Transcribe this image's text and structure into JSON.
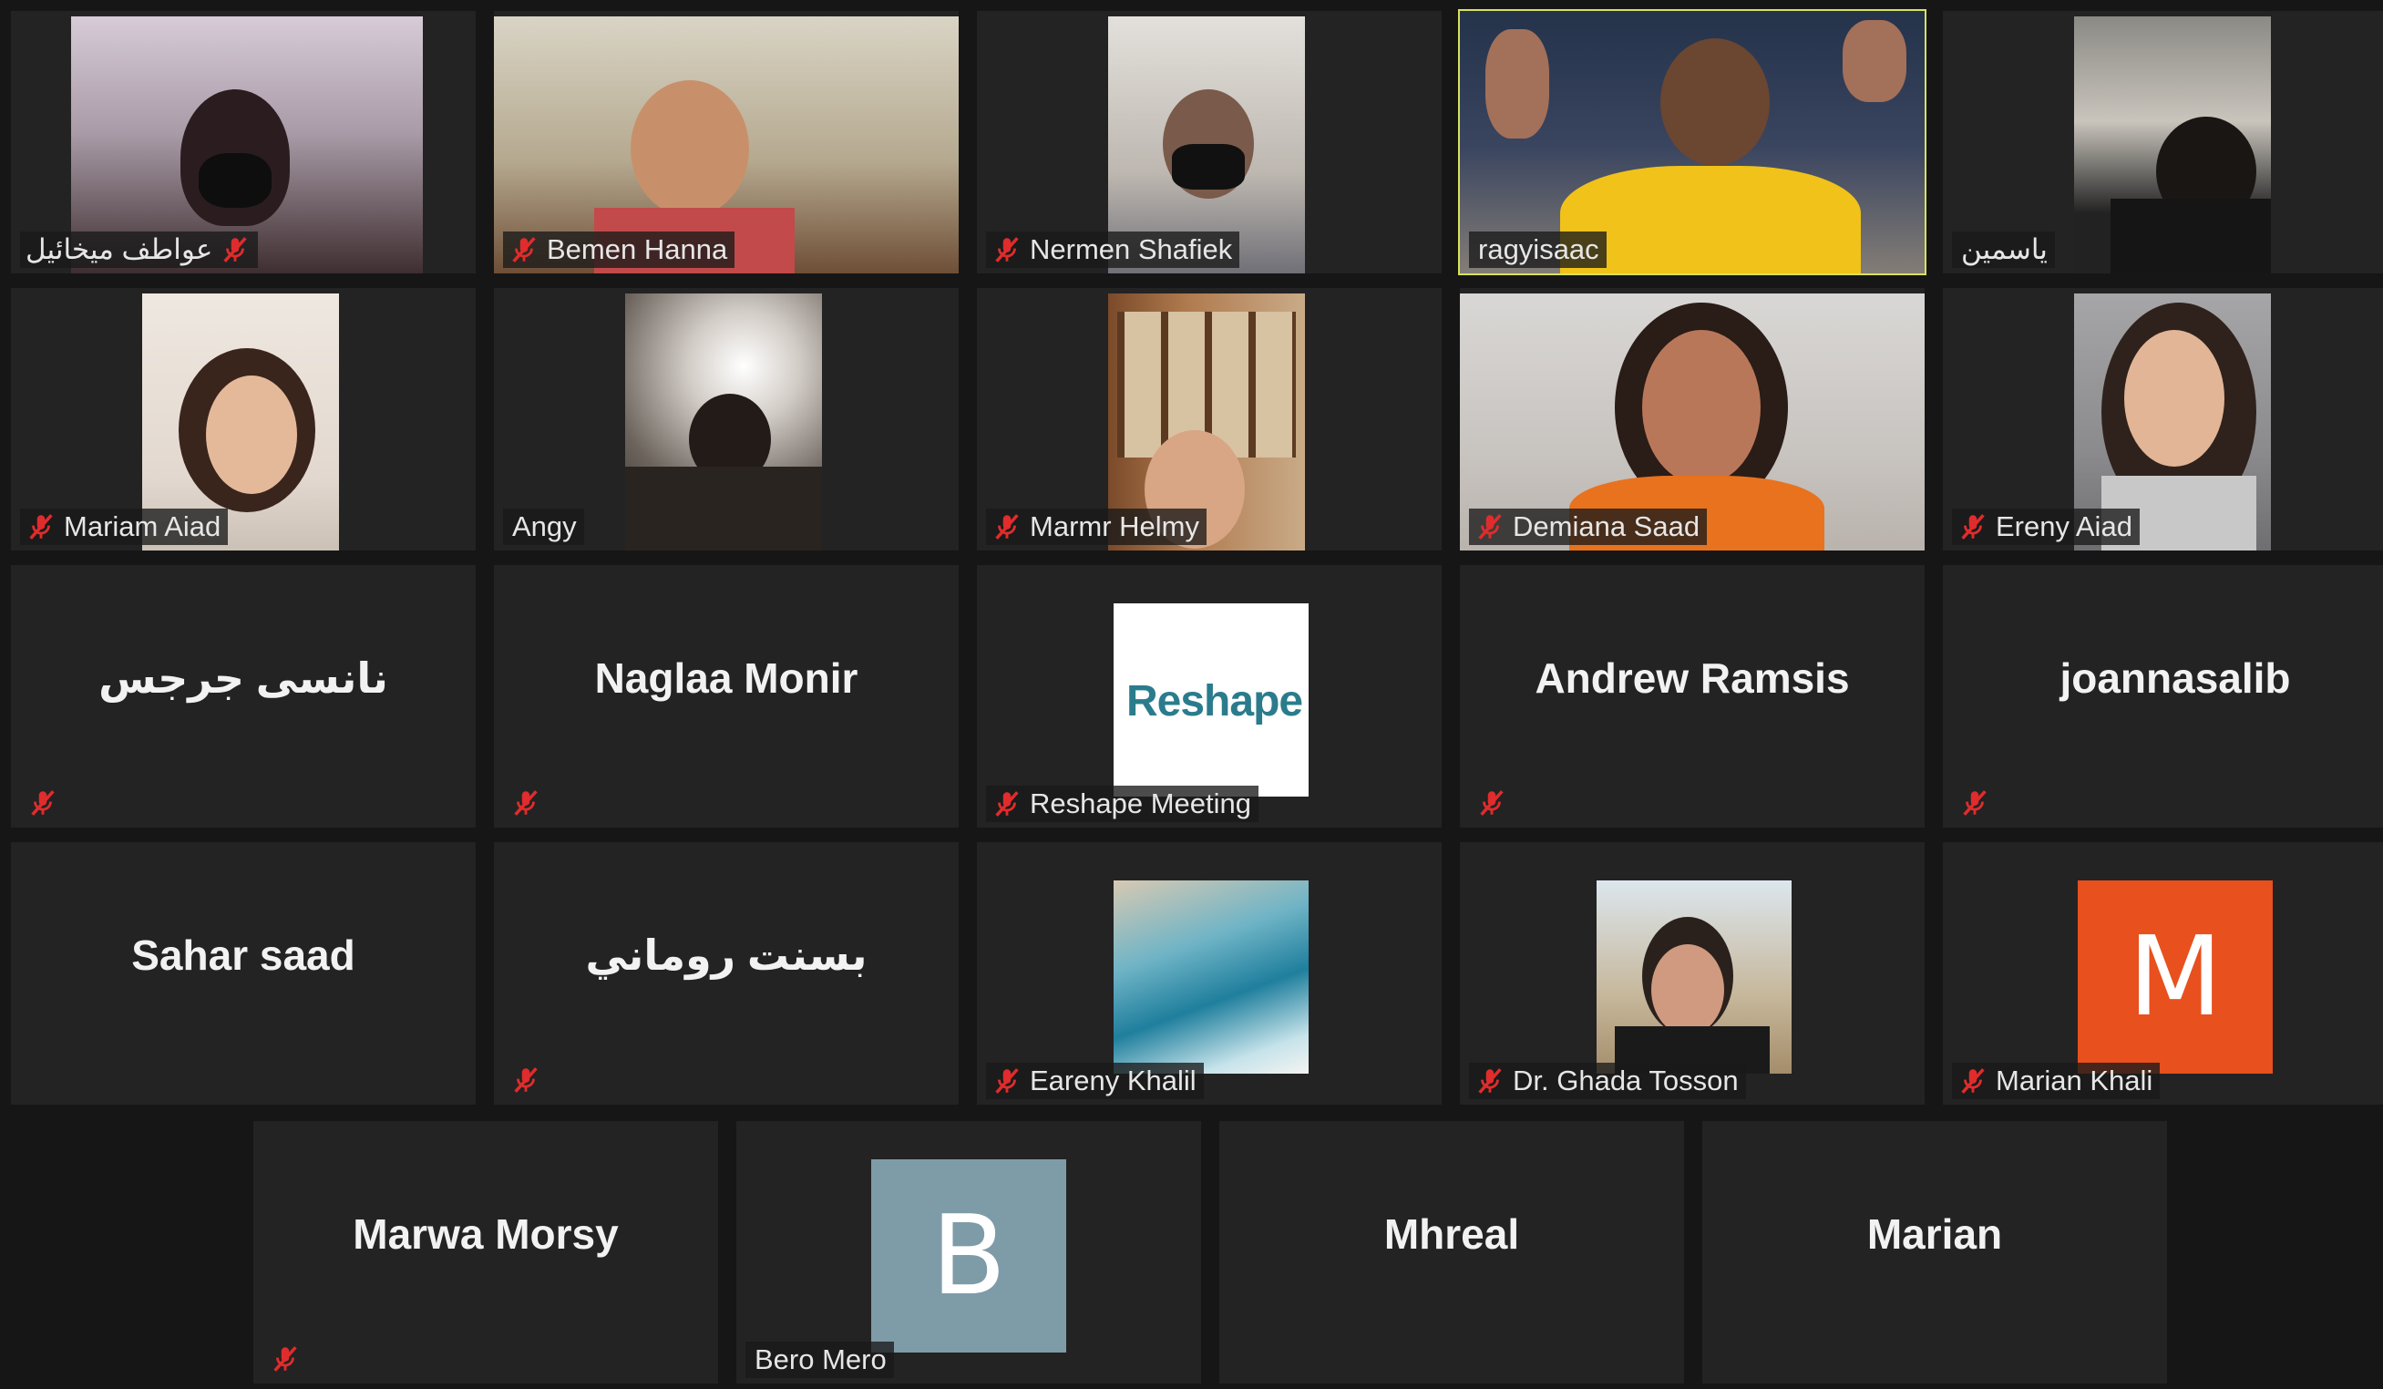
{
  "meeting": {
    "participants": [
      {
        "name": "عواطف ميخائيل",
        "muted": true
      },
      {
        "name": "Bemen Hanna",
        "muted": true
      },
      {
        "name": "Nermen Shafiek",
        "muted": true
      },
      {
        "name": "ragyisaac",
        "muted": false,
        "active_speaker": true
      },
      {
        "name": "ياسمين",
        "muted": false
      },
      {
        "name": "Mariam Aiad",
        "muted": true
      },
      {
        "name": "Angy",
        "muted": false
      },
      {
        "name": "Marmr Helmy",
        "muted": true
      },
      {
        "name": "Demiana Saad",
        "muted": true
      },
      {
        "name": "Ereny Aiad",
        "muted": true
      },
      {
        "name": "نانسى جرجس",
        "muted": true
      },
      {
        "name": "Naglaa Monir",
        "muted": true
      },
      {
        "name": "Reshape Meeting",
        "muted": true,
        "logo_text": "Reshape"
      },
      {
        "name": "Andrew Ramsis",
        "muted": true
      },
      {
        "name": "joannasalib",
        "muted": true
      },
      {
        "name": "Sahar saad",
        "muted": false
      },
      {
        "name": "بسنت روماني",
        "muted": true
      },
      {
        "name": "Eareny Khalil",
        "muted": true
      },
      {
        "name": "Dr. Ghada Tosson",
        "muted": true
      },
      {
        "name": "Marian Khali",
        "muted": true,
        "avatar_letter": "M",
        "avatar_color": "#e8501e"
      },
      {
        "name": "Marwa Morsy",
        "muted": true
      },
      {
        "name": "Bero Mero",
        "muted": false,
        "avatar_letter": "B",
        "avatar_color": "#7e9ba8"
      },
      {
        "name": "Mhreal",
        "muted": false
      },
      {
        "name": "Marian",
        "muted": false
      }
    ]
  },
  "colors": {
    "tile_bg": "#232323",
    "active_border": "#d8e25a",
    "mute_icon": "#e02c2c"
  }
}
